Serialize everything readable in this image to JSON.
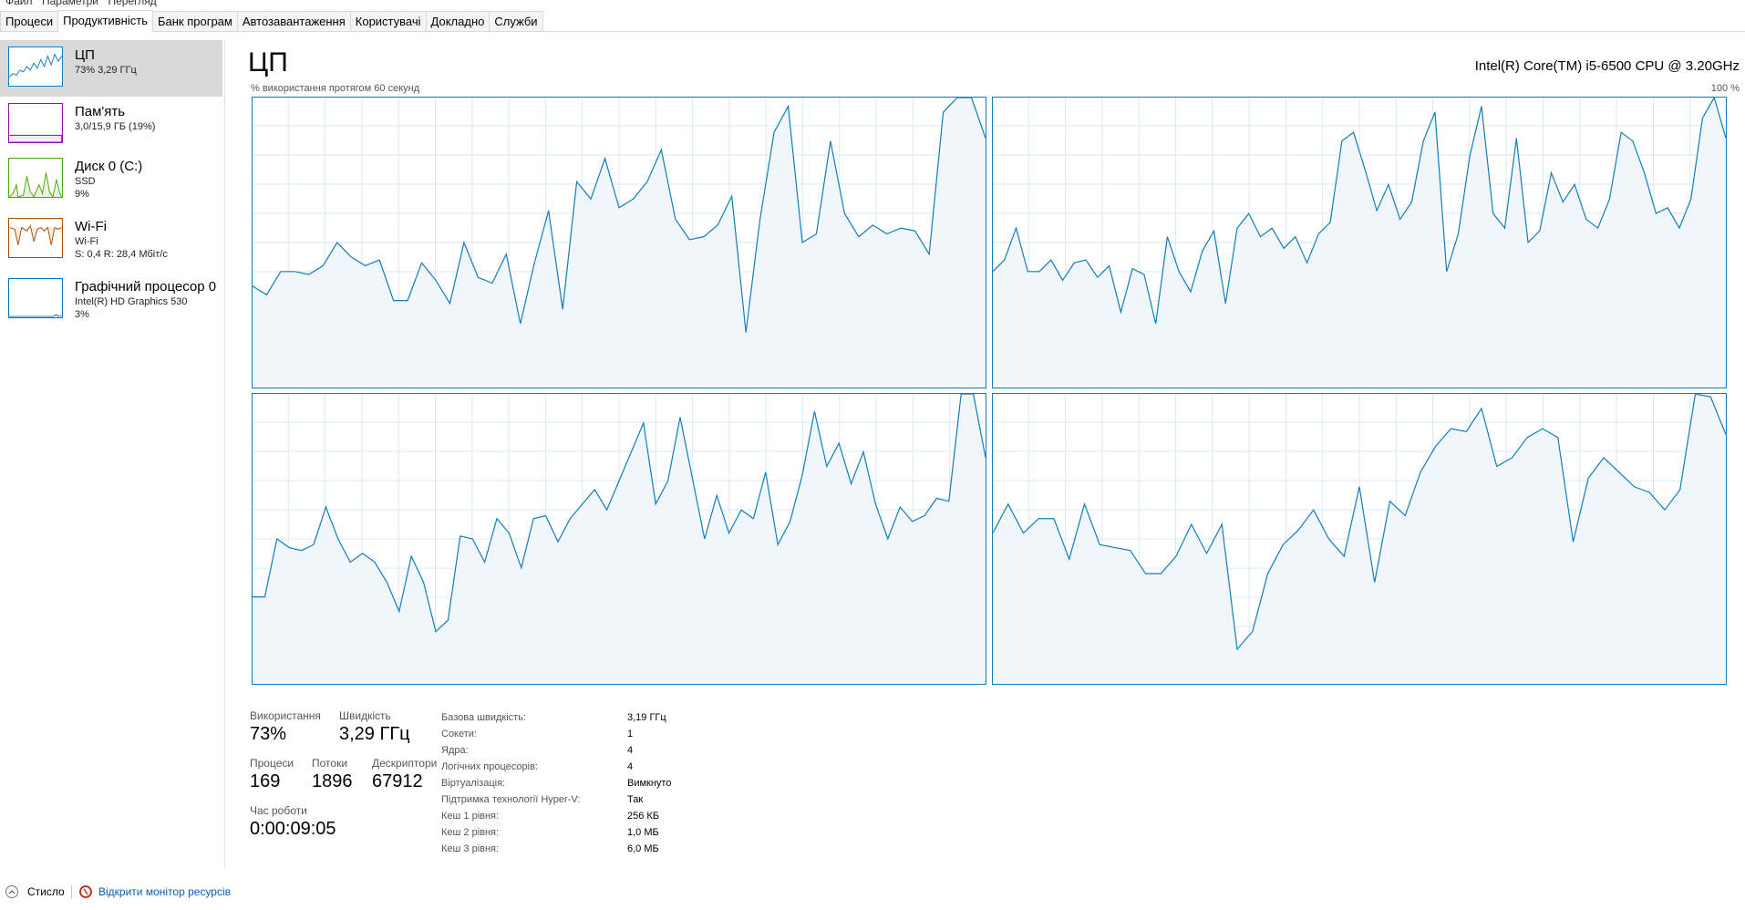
{
  "menu": [
    "Файл",
    "Параметри",
    "Перегляд"
  ],
  "tabs": [
    "Процеси",
    "Продуктивність",
    "Банк програм",
    "Автозавантаження",
    "Користувачі",
    "Докладно",
    "Служби"
  ],
  "active_tab": 1,
  "sidebar": {
    "items": [
      {
        "name": "ЦП",
        "line1": "73% 3,29 ГГц",
        "line2": "",
        "line3": "",
        "color": "#117dbb"
      },
      {
        "name": "Пам'ять",
        "line1": "3,0/15,9 ГБ (19%)",
        "line2": "",
        "line3": "",
        "color": "#8b12ae"
      },
      {
        "name": "Диск 0 (C:)",
        "line1": "SSD",
        "line2": "9%",
        "line3": "",
        "color": "#4da60c"
      },
      {
        "name": "Wi-Fi",
        "line1": "Wi-Fi",
        "line2": "S: 0,4  R: 28,4 Мбіт/с",
        "line3": "",
        "color": "#a74f01"
      },
      {
        "name": "Графічний процесор 0",
        "line1": "Intel(R) HD Graphics 530",
        "line2": "3%",
        "line3": "",
        "color": "#0b70c4"
      }
    ]
  },
  "main": {
    "title": "ЦП",
    "cpu_name": "Intel(R) Core(TM) i5-6500 CPU @ 3.20GHz",
    "ylabel": "% використання протягом 60 секунд",
    "ymax": "100 %"
  },
  "chart_data": {
    "type": "area",
    "series": [
      {
        "values": [
          35,
          32,
          40,
          40,
          39,
          42,
          50,
          45,
          42,
          44,
          30,
          30,
          43,
          37,
          29,
          50,
          38,
          36,
          46,
          22,
          43,
          61,
          27,
          71,
          65,
          79,
          62,
          65,
          71,
          82,
          58,
          51,
          52,
          56,
          66,
          19,
          58,
          88,
          97,
          50,
          53,
          85,
          60,
          52,
          56,
          53,
          55,
          54,
          46,
          95,
          100,
          100,
          86
        ]
      },
      {
        "values": [
          40,
          44,
          55,
          40,
          40,
          44,
          37,
          43,
          44,
          38,
          42,
          26,
          41,
          39,
          22,
          52,
          40,
          33,
          47,
          54,
          29,
          55,
          60,
          52,
          55,
          48,
          52,
          43,
          53,
          57,
          85,
          88,
          75,
          61,
          70,
          58,
          64,
          85,
          95,
          40,
          53,
          80,
          97,
          60,
          55,
          86,
          50,
          54,
          74,
          64,
          70,
          58,
          55,
          65,
          88,
          85,
          74,
          60,
          62,
          55,
          65,
          93,
          100,
          86
        ]
      },
      {
        "values": [
          30,
          30,
          50,
          47,
          46,
          48,
          61,
          50,
          42,
          45,
          42,
          35,
          25,
          44,
          35,
          18,
          22,
          51,
          50,
          42,
          57,
          52,
          40,
          57,
          58,
          49,
          57,
          62,
          67,
          60,
          70,
          80,
          90,
          62,
          70,
          92,
          71,
          50,
          65,
          52,
          60,
          57,
          73,
          48,
          56,
          72,
          94,
          75,
          83,
          69,
          80,
          62,
          50,
          61,
          56,
          58,
          64,
          63,
          100,
          100,
          78
        ]
      },
      {
        "values": [
          52,
          62,
          52,
          57,
          57,
          43,
          62,
          48,
          47,
          46,
          38,
          38,
          44,
          55,
          45,
          55,
          12,
          18,
          38,
          48,
          53,
          60,
          50,
          44,
          68,
          35,
          63,
          58,
          73,
          82,
          88,
          87,
          95,
          75,
          78,
          85,
          88,
          85,
          49,
          71,
          78,
          73,
          68,
          66,
          60,
          67,
          100,
          99,
          86
        ]
      }
    ],
    "ylim": [
      0,
      100
    ]
  },
  "stats": {
    "util_label": "Використання",
    "util_value": "73%",
    "speed_label": "Швидкість",
    "speed_value": "3,29 ГГц",
    "proc_label": "Процеси",
    "proc_value": "169",
    "threads_label": "Потоки",
    "threads_value": "1896",
    "handles_label": "Дескриптори",
    "handles_value": "67912",
    "uptime_label": "Час роботи",
    "uptime_value": "0:00:09:05"
  },
  "details": [
    {
      "label": "Базова швидкість:",
      "value": "3,19 ГГц"
    },
    {
      "label": "Сокети:",
      "value": "1"
    },
    {
      "label": "Ядра:",
      "value": "4"
    },
    {
      "label": "Логічних процесорів:",
      "value": "4"
    },
    {
      "label": "Віртуалізація:",
      "value": "Вимкнуто"
    },
    {
      "label": "Підтримка технології Hyper-V:",
      "value": "Так"
    },
    {
      "label": "Кеш 1 рівня:",
      "value": "256 КБ"
    },
    {
      "label": "Кеш 2 рівня:",
      "value": "1,0 МБ"
    },
    {
      "label": "Кеш 3 рівня:",
      "value": "6,0 МБ"
    }
  ],
  "bottom": {
    "fewer_details": "Стисло",
    "open_monitor": "Відкрити монітор ресурсів"
  },
  "colors": {
    "cpu_line": "#117dbb",
    "cpu_fill": "#f1f6fa",
    "grid": "#d9eaf4"
  }
}
